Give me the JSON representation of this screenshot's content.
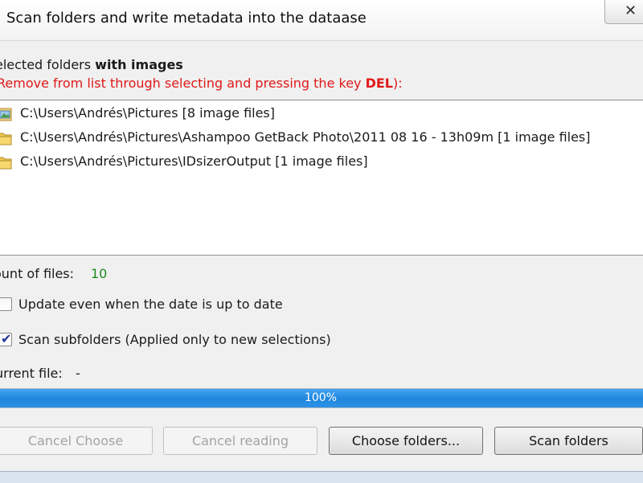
{
  "window": {
    "title": "Scan folders and write metadata into the dataase",
    "close_glyph": "✕"
  },
  "folders": {
    "heading_prefix": "elected folders ",
    "heading_bold": "with images",
    "hint_prefix": "Remove from list through selecting and pressing the key ",
    "hint_key": "DEL",
    "hint_suffix": "):",
    "items": [
      {
        "icon": "pictures-folder-icon",
        "path": "C:\\Users\\Andrés\\Pictures [8 image files]"
      },
      {
        "icon": "folder-icon",
        "path": "C:\\Users\\Andrés\\Pictures\\Ashampoo GetBack Photo\\2011 08 16 - 13h09m [1 image files]"
      },
      {
        "icon": "folder-icon",
        "path": "C:\\Users\\Andrés\\Pictures\\IDsizerOutput [1 image files]"
      }
    ]
  },
  "stats": {
    "count_label": "ount of files:",
    "count_value": "10",
    "current_label": "urrent file:",
    "current_value": "-"
  },
  "options": {
    "update_label": "Update even when the date is up to date",
    "update_checked": false,
    "subfolders_label": "Scan subfolders (Applied only to new selections)",
    "subfolders_checked": true
  },
  "progress": {
    "value": 1.0,
    "text": "100%",
    "color": "#2f92e6"
  },
  "buttons": {
    "cancel_choose": "Cancel Choose",
    "cancel_reading": "Cancel reading",
    "choose_folders": "Choose folders...",
    "scan_folders": "Scan folders"
  }
}
